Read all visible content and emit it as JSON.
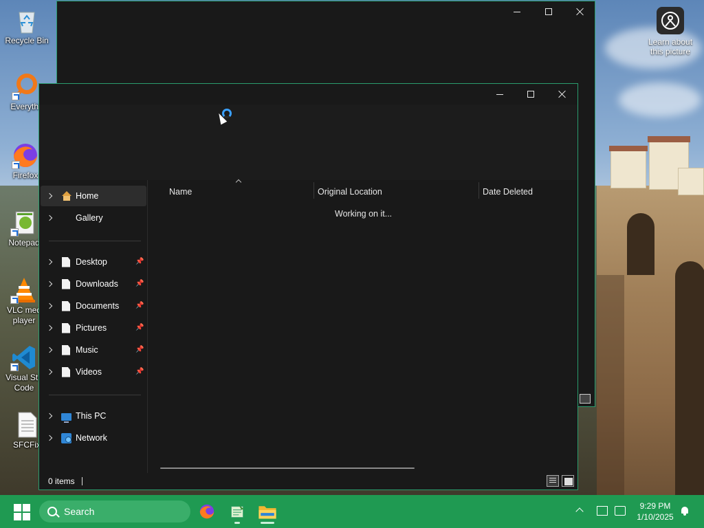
{
  "desktop": {
    "icons": [
      {
        "label": "Recycle Bin",
        "icon": "recycle-bin-icon"
      },
      {
        "label": "Everythi",
        "icon": "everything-search-icon"
      },
      {
        "label": "Firefox",
        "icon": "firefox-icon"
      },
      {
        "label": "Notepad",
        "icon": "notepad-plus-plus-icon"
      },
      {
        "label": "VLC med player",
        "icon": "vlc-icon"
      },
      {
        "label": "Visual Stu Code",
        "icon": "vscode-icon"
      },
      {
        "label": "SFCFix",
        "icon": "text-file-icon"
      }
    ],
    "learn_about": "Learn about this picture"
  },
  "explorer": {
    "nav": {
      "home": "Home",
      "gallery": "Gallery",
      "quick_access": [
        {
          "label": "Desktop"
        },
        {
          "label": "Downloads"
        },
        {
          "label": "Documents"
        },
        {
          "label": "Pictures"
        },
        {
          "label": "Music"
        },
        {
          "label": "Videos"
        }
      ],
      "this_pc": "This PC",
      "network": "Network"
    },
    "columns": {
      "name": "Name",
      "original_location": "Original Location",
      "date_deleted": "Date Deleted"
    },
    "empty_message": "Working on it...",
    "status": {
      "item_count": "0 items"
    }
  },
  "taskbar": {
    "search_label": "Search",
    "clock_time": "9:29 PM",
    "clock_date": "1/10/2025",
    "accent_color": "#1f9a52"
  }
}
